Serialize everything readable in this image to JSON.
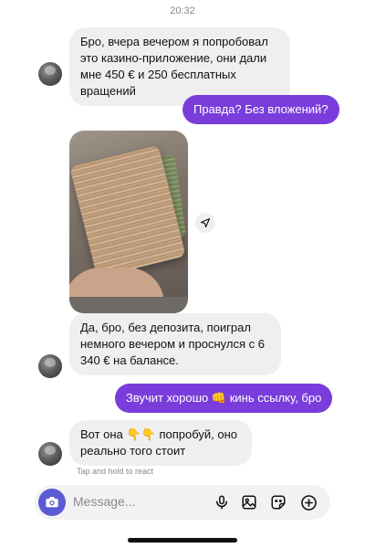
{
  "status": {
    "time": "20:32"
  },
  "messages": [
    {
      "side": "in",
      "text": "Бро, вчера вечером я попробовал это казино-приложение, они дали мне 450 € и 250 бесплатных вращений"
    },
    {
      "side": "out",
      "text": "Правда? Без вложений?"
    },
    {
      "side": "in",
      "type": "photo",
      "icon": "photo-money-icon"
    },
    {
      "side": "in",
      "text": "Да, бро, без депозита, поиграл немного вечером и проснулся с 6 340 € на балансе."
    },
    {
      "side": "out",
      "text_before": "Звучит хорошо",
      "emoji": "👊",
      "text_after": "кинь ссылку, бро"
    },
    {
      "side": "in",
      "text_before": "Вот она",
      "emoji": "👇👇",
      "text_after": "попробуй, оно реально того стоит"
    }
  ],
  "hint": "Tap and hold to react",
  "composer": {
    "placeholder": "Message...",
    "icons": [
      "camera-icon",
      "microphone-icon",
      "gallery-icon",
      "sticker-icon",
      "plus-icon"
    ]
  },
  "colors": {
    "outgoing": "#7a3ddb",
    "incoming": "#efeff1",
    "camera": "#5b5bd6"
  }
}
